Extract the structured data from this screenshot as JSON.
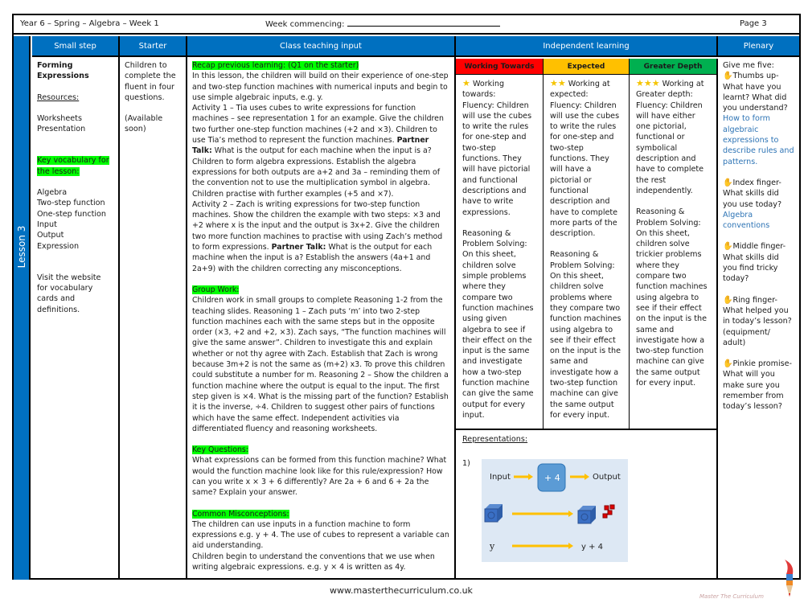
{
  "topbar": {
    "title": "Year 6 – Spring – Algebra – Week 1",
    "week_label": "Week commencing:",
    "page": "Page 3"
  },
  "lesson_label": "Lesson 3",
  "headers": {
    "small_step": "Small step",
    "starter": "Starter",
    "class_teaching": "Class teaching input",
    "independent": "Independent learning",
    "plenary": "Plenary"
  },
  "small_step": {
    "title": "Forming Expressions",
    "resources_label": "Resources:",
    "resources": [
      "Worksheets",
      "Presentation"
    ],
    "vocab_label": "Key vocabulary for the lesson:",
    "vocab": [
      "Algebra",
      "Two-step function",
      "One-step function",
      "Input",
      "Output",
      "Expression"
    ],
    "visit": "Visit the website for vocabulary cards and definitions."
  },
  "starter": {
    "text": "Children to complete the fluent in four questions.",
    "availability": "(Available soon)"
  },
  "class_teaching": {
    "recap_label": "Recap previous learning: (Q1 on the starter)",
    "intro": "In this lesson, the children will build on their experience of one-step and two-step function machines with numerical inputs and begin to use simple algebraic inputs, e.g. y.",
    "activity1_a": "Activity 1 – Tia uses cubes to write expressions for function machines – see representation 1 for an example. Give the children two further one-step function machines (+2 and ×3). Children to use Tia’s method to represent the function machines. ",
    "partner_talk": "Partner Talk:",
    "activity1_b": " What is the output for each machine when the input is a? Children to form algebra expressions. Establish the algebra expressions for both outputs are a+2 and 3a – reminding them of the convention not to use the multiplication symbol in algebra. Children practise with further examples (+5 and ×7).",
    "activity2_a": " Activity 2 – Zach is writing expressions for two-step function machines. Show the children the example with two steps: ×3 and +2 where x is the input and the output is 3x+2. Give the children two more function machines to practise with using Zach’s method to form expressions. ",
    "activity2_b": " What is the output for each machine when the input is a? Establish the answers (4a+1 and 2a+9) with the children correcting any misconceptions.",
    "group_label": "Group Work:",
    "group_text": "Children work in small groups to complete Reasoning 1-2 from the teaching slides. Reasoning 1 – Zach puts ‘m’ into two 2-step function machines each with the same steps but in the opposite order (×3, +2 and +2, ×3). Zach says, “The function machines will give the same answer”. Children to investigate this and explain whether or not thy agree with Zach. Establish that Zach is wrong because 3m+2 is not the same as (m+2) x3. To prove this children could substitute a number for m. Reasoning 2 – Show the children a function machine where the output is equal to the input. The first step given is ×4. What is the missing part of the function? Establish it is the inverse, ÷4. Children to suggest other pairs of functions which have the same effect. Independent activities via differentiated fluency and reasoning worksheets.",
    "key_q_label": "Key Questions:",
    "key_q_text": "What expressions can be formed from this function machine? What would the function machine look like for this rule/expression? How can you write x × 3 + 6 differently? Are 2a + 6 and 6 + 2a the same? Explain your answer.",
    "misc_label": "Common Misconceptions:",
    "misc_text1": "The children can use inputs in a function machine to form expressions e.g. y + 4. The use of cubes to represent a variable can aid understanding.",
    "misc_text2": "Children begin to understand the conventions that we use when writing algebraic expressions. e.g. y × 4 is written as 4y."
  },
  "independent": {
    "levels": [
      {
        "label": "Working Towards",
        "color": "#ff0000",
        "stars": "★",
        "heading": "Working towards:",
        "fluency": "Fluency: Children will use the cubes to write the rules for one-step and two-step functions. They will have pictorial and functional descriptions and have to write expressions.",
        "reasoning": "Reasoning & Problem Solving: On this sheet, children solve simple problems where they compare two function machines using given algebra to see if their effect on the input is the same and investigate how a two-step function machine can give the same output for every input."
      },
      {
        "label": "Expected",
        "color": "#ffc000",
        "stars": "★★",
        "heading": "Working at expected:",
        "fluency": "Fluency: Children will use the cubes to write the rules for one-step and two-step functions. They will have a pictorial or functional description and have to complete more parts of the description.",
        "reasoning": "Reasoning & Problem Solving: On this sheet, children solve problems where they compare two function machines using algebra to see if their effect on the input is the same and investigate how a two-step function machine can give the same output for every input."
      },
      {
        "label": "Greater Depth",
        "color": "#00b050",
        "stars": "★★★",
        "heading": "Working at Greater depth:",
        "fluency": "Fluency: Children will have either one pictorial, functional or symbolical description and have to complete the rest independently.",
        "reasoning": "Reasoning & Problem Solving: On this sheet, children solve trickier problems where they compare two function machines using algebra to see if their effect on the input is the same and investigate how a two-step function machine can give the same output for every input."
      }
    ],
    "representations_label": "Representations:",
    "rep_number": "1)",
    "diagram": {
      "input": "Input",
      "operation": "+ 4",
      "output": "Output",
      "var_in": "y",
      "var_out": "y +  4"
    }
  },
  "plenary": {
    "intro": "Give me five:",
    "items": [
      {
        "finger": "Thumbs up-",
        "question": "What have you learnt? What did you understand?",
        "answer": "How to form algebraic expressions to describe rules and patterns."
      },
      {
        "finger": "Index finger-",
        "question": "What skills did you use today?",
        "answer": "Algebra conventions"
      },
      {
        "finger": "Middle finger-",
        "question": "What skills did you find tricky today?",
        "answer": ""
      },
      {
        "finger": "Ring finger-",
        "question": "What helped you in today’s lesson? (equipment/ adult)",
        "answer": ""
      },
      {
        "finger": "Pinkie promise-",
        "question": "What will you make sure you remember from today’s lesson?",
        "answer": ""
      }
    ]
  },
  "footer": {
    "url": "www.masterthecurriculum.co.uk",
    "brand": "Master The Curriculum"
  }
}
